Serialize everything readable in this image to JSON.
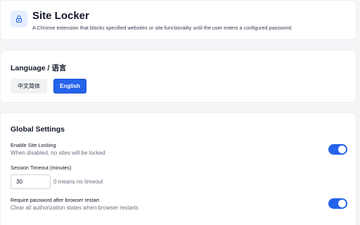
{
  "header": {
    "icon": "lock-icon",
    "title": "Site Locker",
    "description": "A Chrome extension that blocks specified websites or site functionality until the user enters a configured password."
  },
  "language": {
    "title": "Language / 语言",
    "options": [
      {
        "label": "中文简体",
        "selected": false
      },
      {
        "label": "English",
        "selected": true
      }
    ]
  },
  "global_settings": {
    "title": "Global Settings",
    "enable_locking": {
      "label": "Enable Site Locking",
      "help": "When disabled, no sites will be locked",
      "enabled": true
    },
    "session_timeout": {
      "label": "Session Timeout (minutes)",
      "value": "30",
      "hint": "0 means no timeout"
    },
    "require_password_restart": {
      "label": "Require password after browser restart",
      "help": "Clear all authorization states when browser restarts",
      "enabled": true
    }
  },
  "colors": {
    "accent": "#2563eb",
    "icon_bg": "#e6eefc",
    "page_bg": "#f4f5f7"
  }
}
